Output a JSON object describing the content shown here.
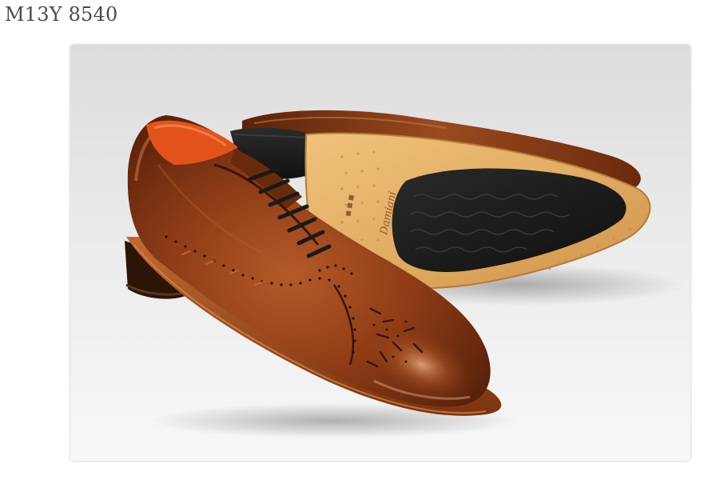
{
  "product": {
    "title": "M13Y 8540",
    "image_alt": "Brown leather brogue oxford shoes",
    "sole_brand_text": "Damiani"
  },
  "colors": {
    "leather": "#8a3a14",
    "leather_dark": "#4e1c08",
    "lining": "#e2531c",
    "sole": "#e2b16a",
    "rubber": "#1b1b1b",
    "background": "#e8e8e8"
  }
}
